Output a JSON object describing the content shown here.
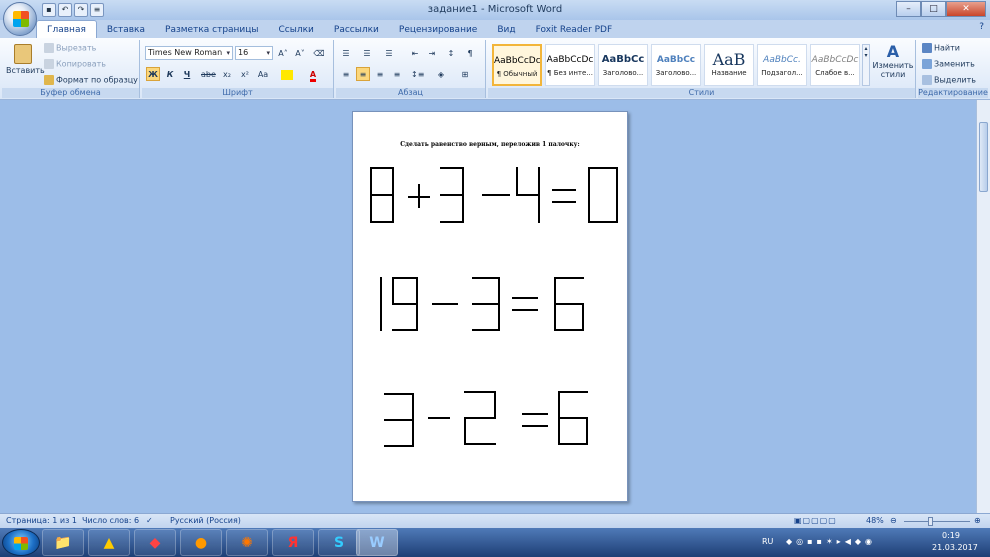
{
  "window": {
    "title": "задание1 - Microsoft Word"
  },
  "tabs": [
    {
      "label": "Главная",
      "active": true
    },
    {
      "label": "Вставка"
    },
    {
      "label": "Разметка страницы"
    },
    {
      "label": "Ссылки"
    },
    {
      "label": "Рассылки"
    },
    {
      "label": "Рецензирование"
    },
    {
      "label": "Вид"
    },
    {
      "label": "Foxit Reader PDF"
    }
  ],
  "clipboard": {
    "paste": "Вставить",
    "cut": "Вырезать",
    "copy": "Копировать",
    "format": "Формат по образцу",
    "group": "Буфер обмена"
  },
  "font": {
    "name": "Times New Roman",
    "size": "16",
    "group": "Шрифт",
    "bold": "Ж",
    "italic": "К",
    "underline": "Ч",
    "strike": "abe",
    "sub": "x₂",
    "sup": "x²",
    "case": "Aa",
    "grow": "A˄",
    "shrink": "A˅"
  },
  "paragraph": {
    "group": "Абзац"
  },
  "styles": {
    "group": "Стили",
    "items": [
      {
        "preview": "AaBbCcDc",
        "name": "¶ Обычный",
        "selected": true
      },
      {
        "preview": "AaBbCcDc",
        "name": "¶ Без инте..."
      },
      {
        "preview": "AaBbCc",
        "name": "Заголово..."
      },
      {
        "preview": "AaBbCc",
        "name": "Заголово..."
      },
      {
        "preview": "AaB",
        "name": "Название"
      },
      {
        "preview": "AaBbCc.",
        "name": "Подзагол..."
      },
      {
        "preview": "AaBbCcDc",
        "name": "Слабое в..."
      }
    ],
    "change": "Изменить стили"
  },
  "editing": {
    "group": "Редактирование",
    "find": "Найти",
    "replace": "Заменить",
    "select": "Выделить"
  },
  "document": {
    "heading": "Сделать равенство верным, переложив 1 палочку:",
    "equations": [
      "8+3-4=0",
      "19-3=6",
      "3-2=6"
    ]
  },
  "status": {
    "page": "Страница: 1 из 1",
    "words": "Число слов: 6",
    "lang": "Русский (Россия)",
    "zoom": "48%",
    "zoom_value": 0.48
  },
  "tray": {
    "lang": "RU",
    "time": "0:19",
    "date": "21.03.2017"
  }
}
